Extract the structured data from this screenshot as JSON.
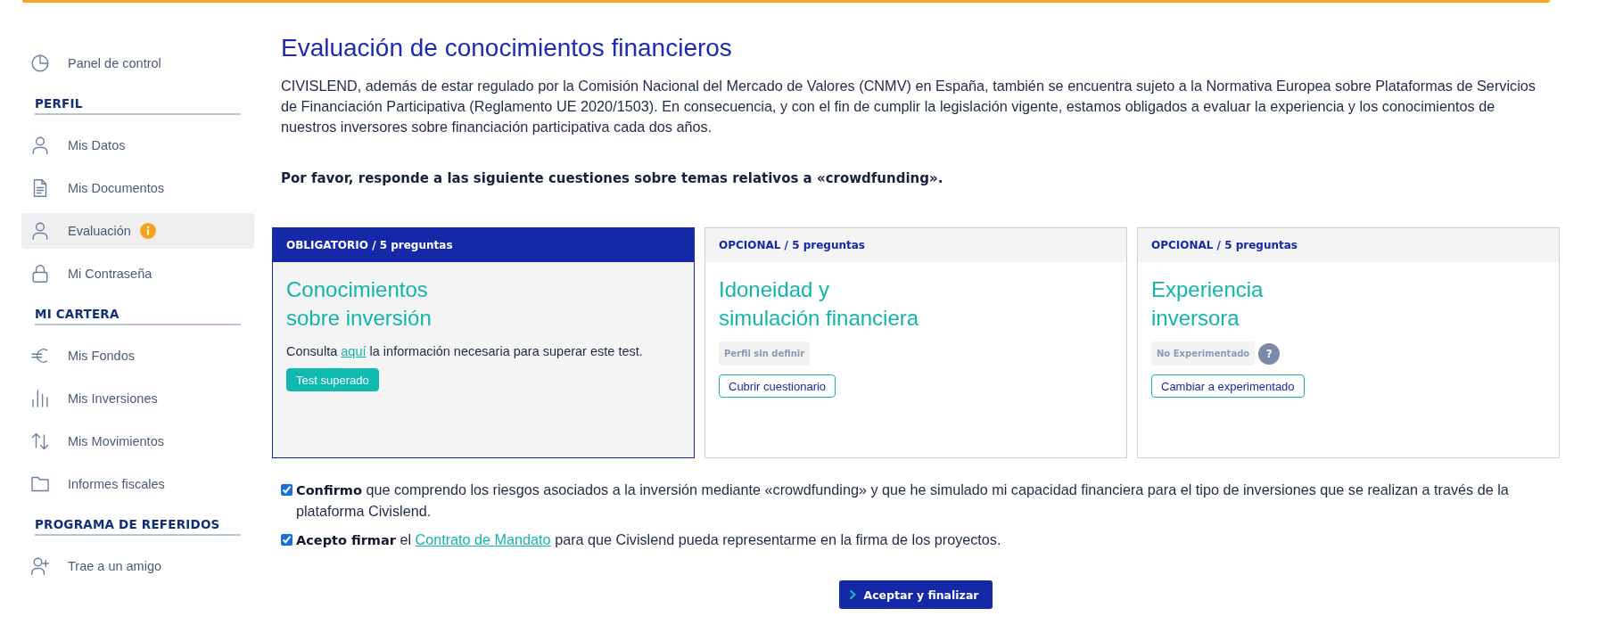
{
  "sidebar": [
    {
      "items": [
        {
          "label": "Panel de control",
          "selected": false,
          "alert": false
        }
      ]
    },
    {
      "heading": "PERFIL",
      "items": [
        {
          "label": "Mis Datos",
          "selected": false,
          "alert": false
        },
        {
          "label": "Mis Documentos",
          "selected": false,
          "alert": false
        },
        {
          "label": "Evaluación",
          "selected": true,
          "alert": true
        },
        {
          "label": "Mi Contraseña",
          "selected": false,
          "alert": false
        }
      ]
    },
    {
      "heading": "MI CARTERA",
      "items": [
        {
          "label": "Mis Fondos",
          "selected": false,
          "alert": false
        },
        {
          "label": "Mis Inversiones",
          "selected": false,
          "alert": false
        },
        {
          "label": "Mis Movimientos",
          "selected": false,
          "alert": false
        },
        {
          "label": "Informes fiscales",
          "selected": false,
          "alert": false
        }
      ]
    },
    {
      "heading": "PROGRAMA DE REFERIDOS",
      "items": [
        {
          "label": "Trae a un amigo",
          "selected": false,
          "alert": false
        }
      ]
    }
  ],
  "main": {
    "title": "Evaluación de conocimientos financieros",
    "intro": "CIVISLEND, además de estar regulado por la Comisión Nacional del Mercado de Valores (CNMV) en España, también se encuentra sujeto a la Normativa Europea sobre Plataformas de Servicios de Financiación Participativa (Reglamento UE 2020/1503). En consecuencia, y con el fin de cumplir la legislación vigente, estamos obligados a evaluar la experiencia y los conocimientos de nuestros inversores sobre financiación participativa cada dos años.",
    "instruction": "Por favor, responde a las siguiente cuestiones sobre temas relativos a «crowdfunding»."
  },
  "cards": [
    {
      "header": "OBLIGATORIO / 5 preguntas",
      "required": true,
      "title": "Conocimientos\nsobre inversión",
      "note": {
        "before": "Consulta",
        "link": "aquí",
        "after": "la información necesaria para superar este test."
      },
      "action": {
        "label": "Test superado",
        "kind": "filled"
      }
    },
    {
      "header": "OPCIONAL / 5 preguntas",
      "required": false,
      "title": "Idoneidad y\nsimulación financiera",
      "status": "Perfil sin definir",
      "action": {
        "label": "Cubrir cuestionario",
        "kind": "outline"
      }
    },
    {
      "header": "OPCIONAL / 5 preguntas",
      "required": false,
      "title": "Experiencia\ninversora",
      "status": "No Experimentado",
      "help": "?",
      "action": {
        "label": "Cambiar a experimentado",
        "kind": "outline"
      }
    }
  ],
  "agreements": [
    {
      "checked": true,
      "lead": "Confirmo",
      "text": "que comprendo los riesgos asociados a la inversión mediante «crowdfunding» y que he simulado mi capacidad financiera para el tipo de inversiones que se realizan a través de la plataforma Civislend."
    },
    {
      "checked": true,
      "lead": "Acepto firmar",
      "text": "el",
      "link": "Contrato de Mandato",
      "after": "para que Civislend pueda representarme en la firma de los proyectos."
    }
  ],
  "submit": {
    "label": "Aceptar y finalizar"
  }
}
